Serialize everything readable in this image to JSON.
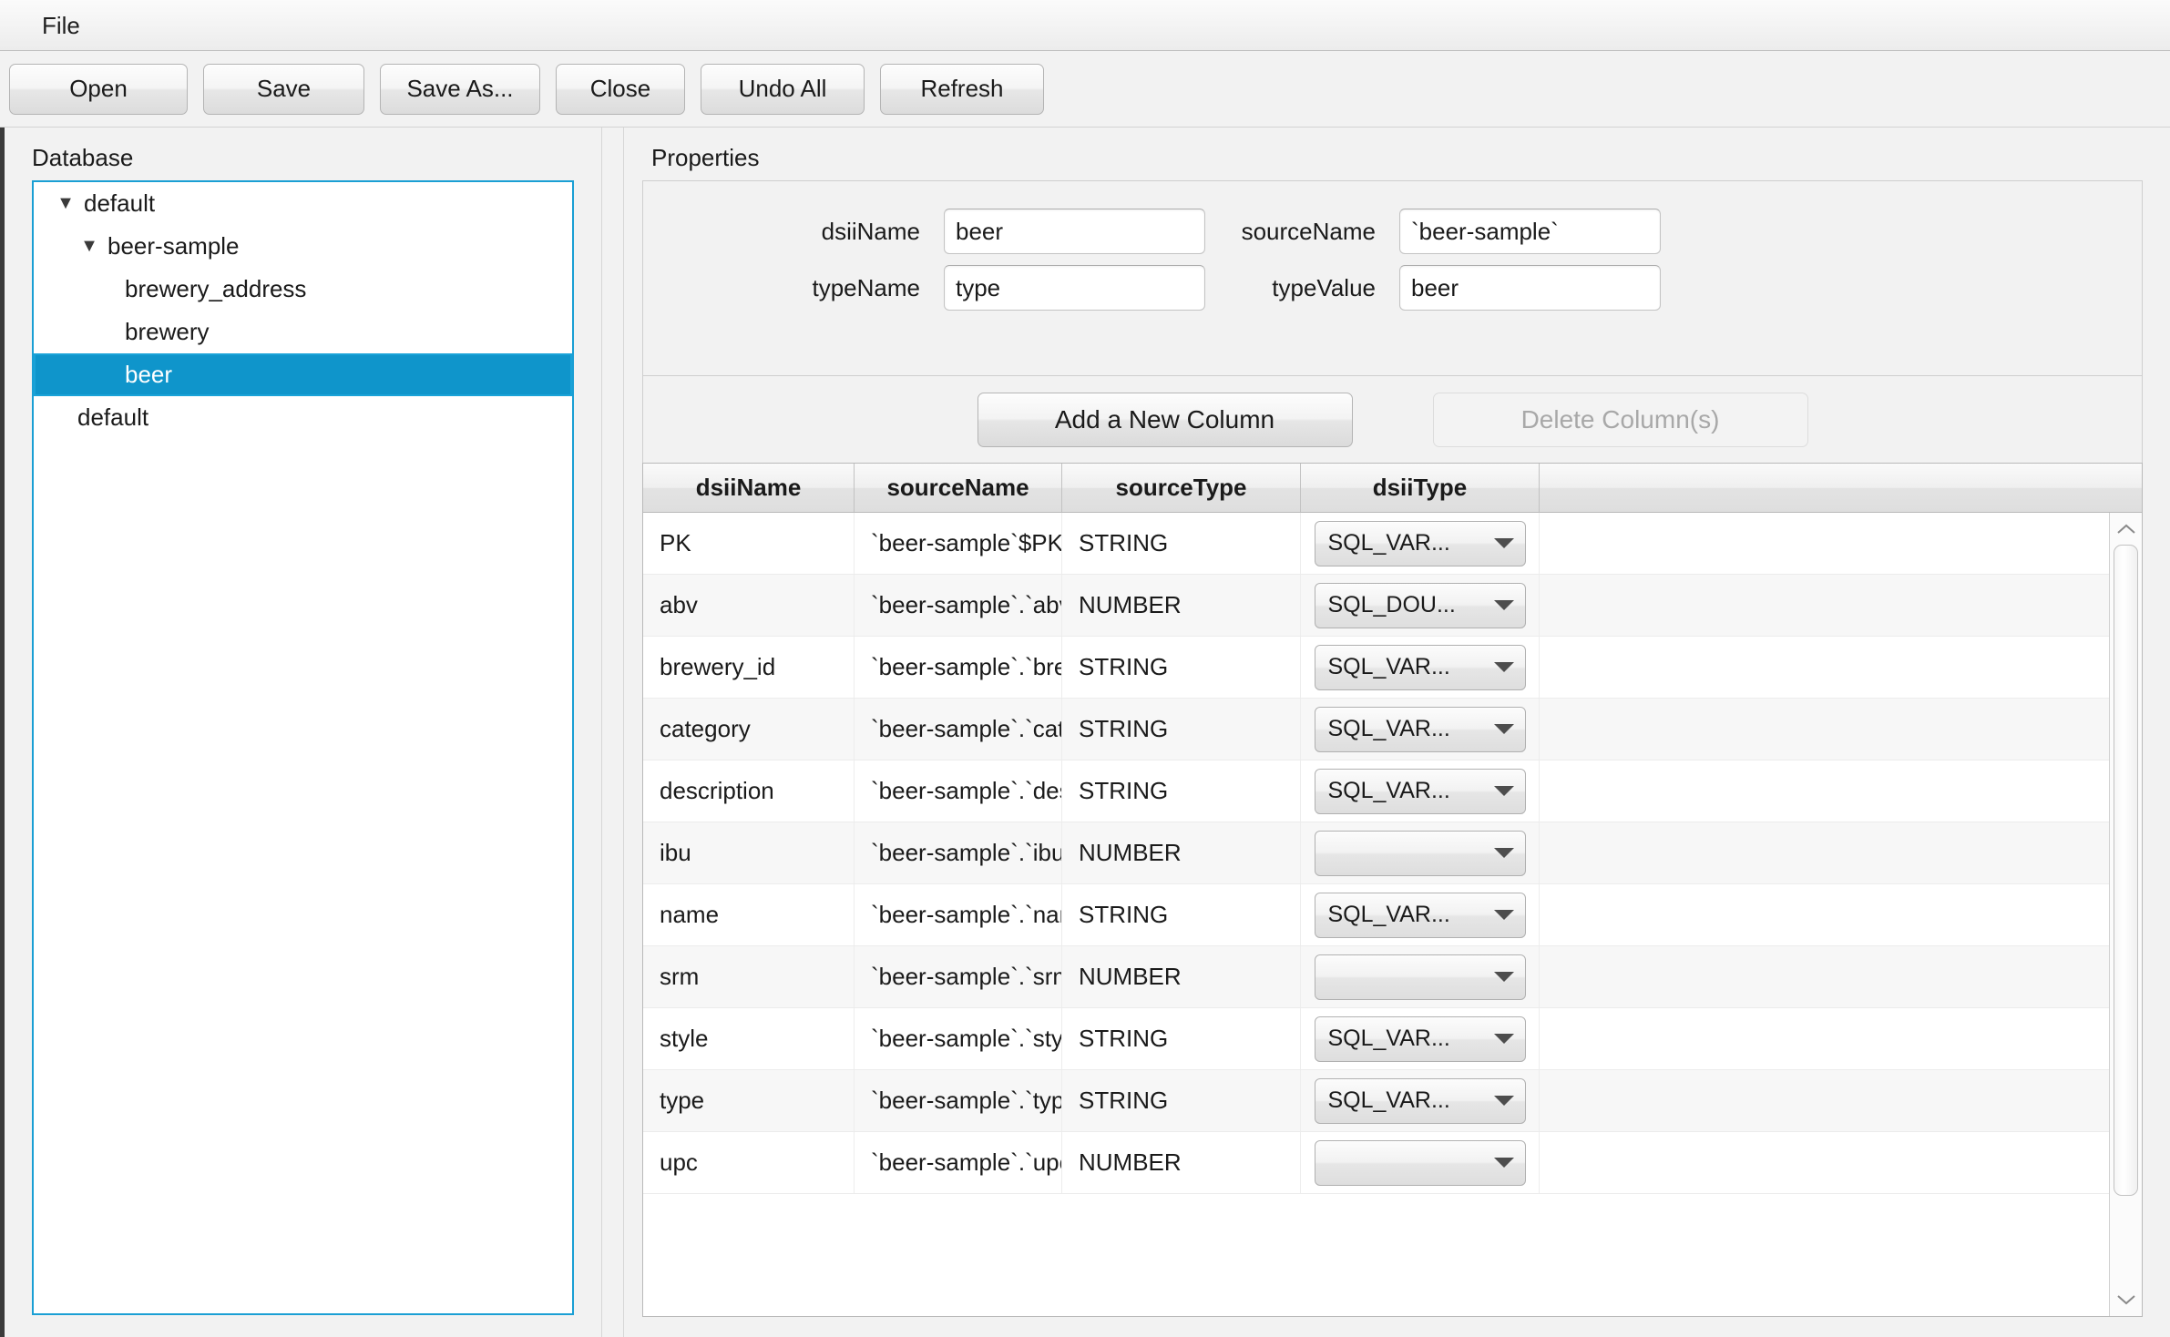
{
  "menubar": {
    "items": [
      {
        "label": "File"
      }
    ]
  },
  "toolbar": {
    "buttons": [
      {
        "label": "Open"
      },
      {
        "label": "Save"
      },
      {
        "label": "Save As..."
      },
      {
        "label": "Close"
      },
      {
        "label": "Undo All"
      },
      {
        "label": "Refresh"
      }
    ]
  },
  "left_panel": {
    "title": "Database",
    "tree": [
      {
        "label": "default",
        "level": 0,
        "twisty": "▼",
        "selected": false
      },
      {
        "label": "beer-sample",
        "level": 1,
        "twisty": "▼",
        "selected": false
      },
      {
        "label": "brewery_address",
        "level": 2,
        "twisty": "",
        "selected": false
      },
      {
        "label": "brewery",
        "level": 2,
        "twisty": "",
        "selected": false
      },
      {
        "label": "beer",
        "level": 2,
        "twisty": "",
        "selected": true
      },
      {
        "label": "default",
        "level": 1,
        "twisty": "",
        "selected": false
      }
    ]
  },
  "right_panel": {
    "title": "Properties",
    "form": {
      "dsiiName_label": "dsiiName",
      "dsiiName_value": "beer",
      "sourceName_label": "sourceName",
      "sourceName_value": "`beer-sample`",
      "typeName_label": "typeName",
      "typeName_value": "type",
      "typeValue_label": "typeValue",
      "typeValue_value": "beer"
    },
    "column_actions": {
      "add_label": "Add a New Column",
      "delete_label": "Delete Column(s)"
    },
    "table": {
      "headers": [
        "dsiiName",
        "sourceName",
        "sourceType",
        "dsiiType",
        ""
      ],
      "rows": [
        {
          "dsiiName": "PK",
          "sourceName": "`beer-sample`$PK",
          "sourceType": "STRING",
          "dsiiType": "SQL_VAR..."
        },
        {
          "dsiiName": "abv",
          "sourceName": "`beer-sample`.`abv",
          "sourceType": "NUMBER",
          "dsiiType": "SQL_DOU..."
        },
        {
          "dsiiName": "brewery_id",
          "sourceName": "`beer-sample`.`bre",
          "sourceType": "STRING",
          "dsiiType": "SQL_VAR..."
        },
        {
          "dsiiName": "category",
          "sourceName": "`beer-sample`.`cat",
          "sourceType": "STRING",
          "dsiiType": "SQL_VAR..."
        },
        {
          "dsiiName": "description",
          "sourceName": "`beer-sample`.`des",
          "sourceType": "STRING",
          "dsiiType": "SQL_VAR..."
        },
        {
          "dsiiName": "ibu",
          "sourceName": "`beer-sample`.`ibu",
          "sourceType": "NUMBER",
          "dsiiType": ""
        },
        {
          "dsiiName": "name",
          "sourceName": "`beer-sample`.`nam",
          "sourceType": "STRING",
          "dsiiType": "SQL_VAR..."
        },
        {
          "dsiiName": "srm",
          "sourceName": "`beer-sample`.`srm",
          "sourceType": "NUMBER",
          "dsiiType": ""
        },
        {
          "dsiiName": "style",
          "sourceName": "`beer-sample`.`sty",
          "sourceType": "STRING",
          "dsiiType": "SQL_VAR..."
        },
        {
          "dsiiName": "type",
          "sourceName": "`beer-sample`.`typ",
          "sourceType": "STRING",
          "dsiiType": "SQL_VAR..."
        },
        {
          "dsiiName": "upc",
          "sourceName": "`beer-sample`.`upc",
          "sourceType": "NUMBER",
          "dsiiType": ""
        }
      ]
    }
  }
}
